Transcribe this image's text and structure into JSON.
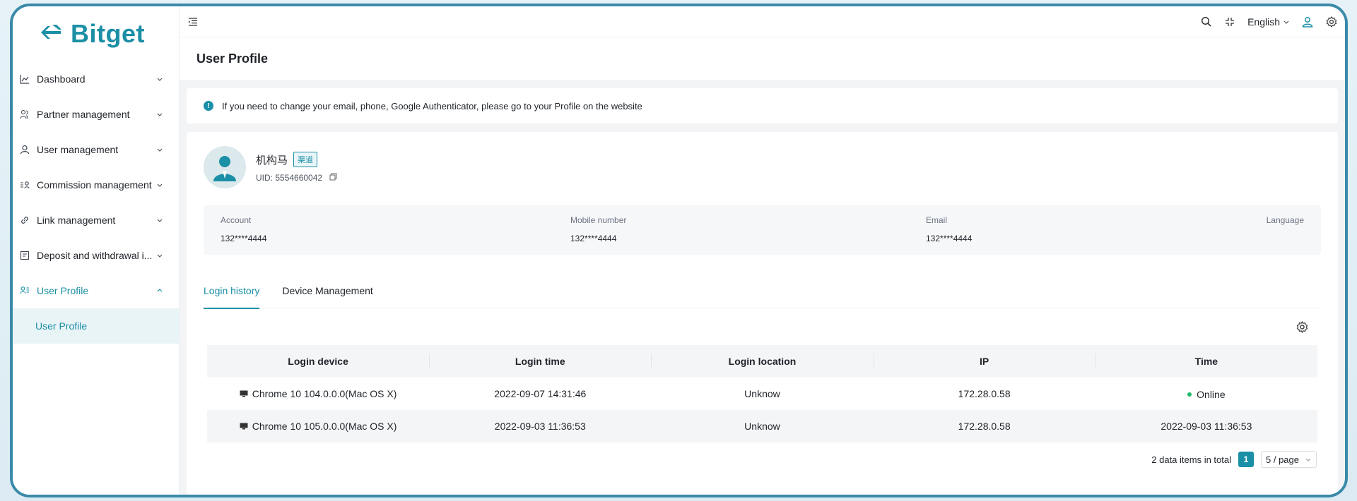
{
  "brand": {
    "name": "Bitget",
    "accent": "#1b8fa6"
  },
  "sidebar": {
    "items": [
      {
        "label": "Dashboard",
        "icon": "chart-line-icon"
      },
      {
        "label": "Partner management",
        "icon": "partners-icon"
      },
      {
        "label": "User management",
        "icon": "user-icon"
      },
      {
        "label": "Commission management",
        "icon": "commission-icon"
      },
      {
        "label": "Link management",
        "icon": "link-icon"
      },
      {
        "label": "Deposit and withdrawal i...",
        "icon": "deposit-icon"
      },
      {
        "label": "User Profile",
        "icon": "user-profile-icon",
        "expanded": true
      }
    ],
    "submenu": [
      {
        "label": "User Profile",
        "selected": true
      }
    ]
  },
  "topbar": {
    "language": "English"
  },
  "page": {
    "title": "User Profile"
  },
  "notice": {
    "text": "If you need to change your email, phone, Google Authenticator, please go to your Profile on the website"
  },
  "profile": {
    "name": "机构马",
    "tag": "渠道",
    "uid_label": "UID:",
    "uid": "5554660042",
    "info": {
      "account_label": "Account",
      "account_value": "132****4444",
      "mobile_label": "Mobile number",
      "mobile_value": "132****4444",
      "email_label": "Email",
      "email_value": "132****4444",
      "language_label": "Language",
      "language_value": ""
    }
  },
  "tabs": [
    {
      "label": "Login history",
      "active": true
    },
    {
      "label": "Device Management",
      "active": false
    }
  ],
  "table": {
    "columns": [
      "Login device",
      "Login time",
      "Login location",
      "IP",
      "Time"
    ],
    "rows": [
      {
        "device": "Chrome 10 104.0.0.0(Mac OS X)",
        "login_time": "2022-09-07 14:31:46",
        "location": "Unknow",
        "ip": "172.28.0.58",
        "time": "Online"
      },
      {
        "device": "Chrome 10 105.0.0.0(Mac OS X)",
        "login_time": "2022-09-03 11:36:53",
        "location": "Unknow",
        "ip": "172.28.0.58",
        "time": "2022-09-03 11:36:53"
      }
    ]
  },
  "pagination": {
    "total_text": "2 data items in total",
    "current_page": "1",
    "page_size": "5 / page"
  }
}
